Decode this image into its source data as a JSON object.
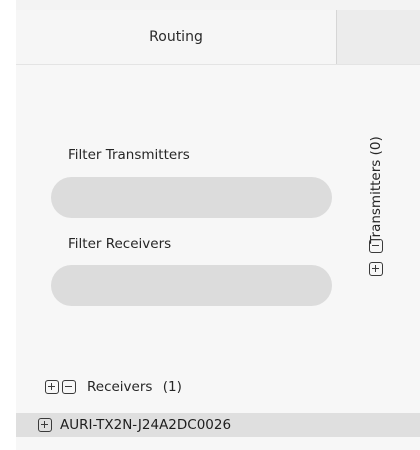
{
  "tabs": {
    "routing_label": "Routing",
    "other_label": ""
  },
  "filters": {
    "transmitters_label": "Filter Transmitters",
    "transmitters_value": "",
    "receivers_label": "Filter Receivers",
    "receivers_value": ""
  },
  "transmitters": {
    "label": "Transmitters",
    "count": "(0)"
  },
  "receivers": {
    "label": "Receivers",
    "count": "(1)",
    "items": [
      {
        "name": "AURI-TX2N-J24A2DC0026"
      }
    ]
  },
  "colors": {
    "panel_bg": "#f7f7f7",
    "tab_bg": "#f1f1f1",
    "pill_bg": "#dcdcdc",
    "selected_row_bg": "#dfdfdf",
    "text": "#262626",
    "icon_stroke": "#3a3a3a"
  },
  "icons": {
    "expand": "plus-square-icon",
    "collapse": "minus-square-icon"
  }
}
